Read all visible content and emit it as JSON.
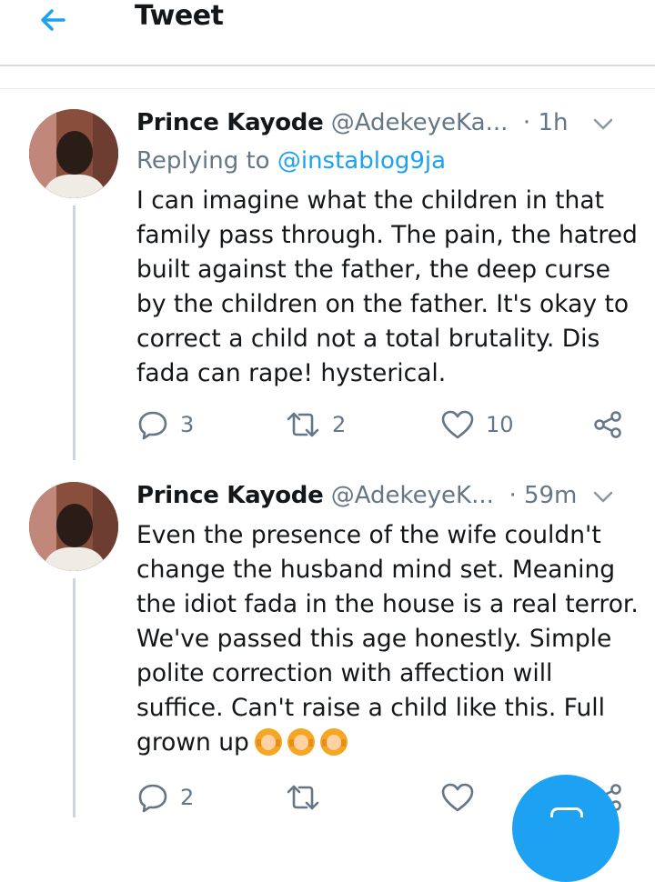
{
  "header": {
    "title": "Tweet",
    "back_icon": "arrow-left-icon",
    "accent": "#1da1f2"
  },
  "tweets": [
    {
      "name": "Prince Kayode",
      "handle": "@AdekeyeKa...",
      "time": "· 1h",
      "replying_prefix": "Replying to ",
      "replying_to": "@instablog9ja",
      "lines": [
        "I can imagine what the children in that",
        "family pass through. The pain, the hatred",
        "built against the father, the deep curse",
        "by the children on the father. It's okay to",
        "correct a child not a total brutality. Dis",
        "fada can rape! hysterical."
      ],
      "reply_count": "3",
      "retweet_count": "2",
      "like_count": "10"
    },
    {
      "name": "Prince Kayode",
      "handle": "@AdekeyeK...",
      "time": "· 59m",
      "lines": [
        "Even the presence of the wife couldn't",
        "change the husband mind set. Meaning",
        "the idiot fada in the house is a real terror.",
        "We've passed this age honestly. Simple",
        "polite correction with affection will",
        "suffice. Can't raise a child like this. Full",
        "grown up"
      ],
      "emojis": [
        "person-gesturing-ok-icon",
        "person-gesturing-ok-icon",
        "person-gesturing-ok-icon"
      ],
      "reply_count": "2",
      "retweet_count": "",
      "like_count": ""
    }
  ],
  "colors": {
    "text": "#14171a",
    "muted": "#657786",
    "link": "#1da1f2",
    "divider": "#d6dadd"
  }
}
